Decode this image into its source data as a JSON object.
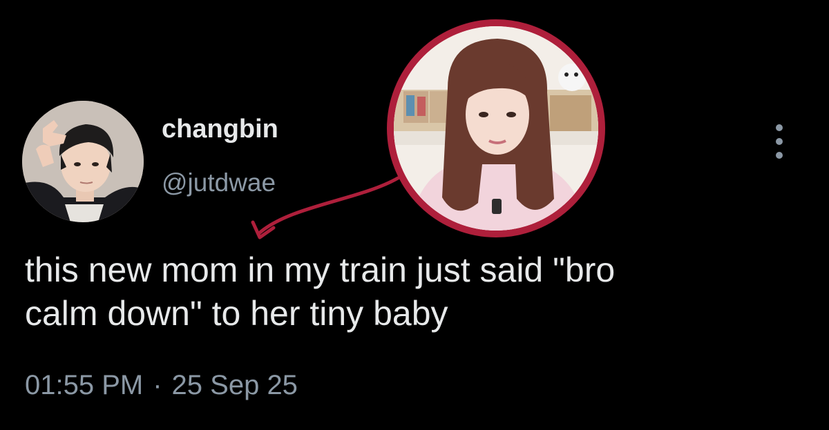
{
  "tweet": {
    "author": {
      "display_name": "changbin",
      "handle": "@jutdwae",
      "avatar_icon": "user-avatar-photo"
    },
    "text": "this new mom in my train just said \"bro\ncalm down\" to her tiny baby",
    "time": "01:55 PM",
    "separator": "·",
    "date": "25 Sep 25",
    "more_icon": "more-options-icon"
  },
  "annotation": {
    "photo_icon": "inset-person-photo",
    "ring_color": "#ae1f3b",
    "arrow_color": "#ae1f3b"
  },
  "colors": {
    "background": "#000000",
    "primary_text": "#e7e9ea",
    "secondary_text": "#8b98a5"
  }
}
